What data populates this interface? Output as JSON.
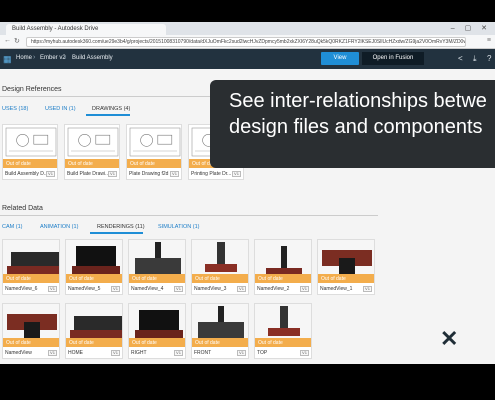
{
  "browser": {
    "tab_title": "Build Assembly - Autodesk Drive",
    "url": "https://myhub.autodesk360.com/ue29e3b4/g/projects/20151008310790/data/dXJuOmFkc2sud2lwcHJvZDpmcy5mb2xkZXI6Y28uQk5kQ0RKZ1FRY2lKSEJ0SllUcHZxdw/ZG9ja2V0OmRvY3M/ZD0wfDc5NDk5Njc5MDI3NA/previewDetails=overview"
  },
  "header": {
    "breadcrumb": [
      "Home",
      "Ember v2",
      "Build Assembly"
    ],
    "view_label": "View",
    "open_fusion_label": "Open in Fusion"
  },
  "tooltip": {
    "line1": "See inter-relationships betwe",
    "line2": "design files and components"
  },
  "design_refs": {
    "title": "Design References",
    "tabs": [
      "USES (18)",
      "USED IN (1)",
      "DRAWINGS (4)"
    ],
    "active_tab": 2,
    "cards": [
      {
        "status": "Out of date",
        "name": "Build Assembly D...",
        "count": "V1"
      },
      {
        "status": "Out of date",
        "name": "Build Plate Drawi...",
        "count": "V1"
      },
      {
        "status": "Out of date",
        "name": "Plate Drawing f2d",
        "count": "V1"
      },
      {
        "status": "Out of date",
        "name": "Printing Plate Dr...",
        "count": "V1"
      }
    ]
  },
  "related": {
    "title": "Related Data",
    "tabs": [
      "CAM (1)",
      "ANIMATION (1)",
      "RENDERINGS (11)",
      "SIMULATION (1)"
    ],
    "active_tab": 2,
    "row1": [
      {
        "status": "Out of date",
        "name": "NamedView_6",
        "count": "V1"
      },
      {
        "status": "Out of date",
        "name": "NamedView_5",
        "count": "V1"
      },
      {
        "status": "Out of date",
        "name": "NamedView_4",
        "count": "V1"
      },
      {
        "status": "Out of date",
        "name": "NamedView_3",
        "count": "V1"
      },
      {
        "status": "Out of date",
        "name": "NamedView_2",
        "count": "V1"
      },
      {
        "status": "Out of date",
        "name": "NamedView_1",
        "count": "V1"
      }
    ],
    "row2": [
      {
        "status": "Out of date",
        "name": "NamedView",
        "count": "V1"
      },
      {
        "status": "Out of date",
        "name": "HOME",
        "count": "V1"
      },
      {
        "status": "Out of date",
        "name": "RIGHT",
        "count": "V1"
      },
      {
        "status": "Out of date",
        "name": "FRONT",
        "count": "V1"
      },
      {
        "status": "Out of date",
        "name": "TOP",
        "count": "V1"
      }
    ]
  },
  "colors": {
    "accent": "#1f8ed6",
    "badge": "#f3ad4c",
    "header": "#22323f"
  }
}
